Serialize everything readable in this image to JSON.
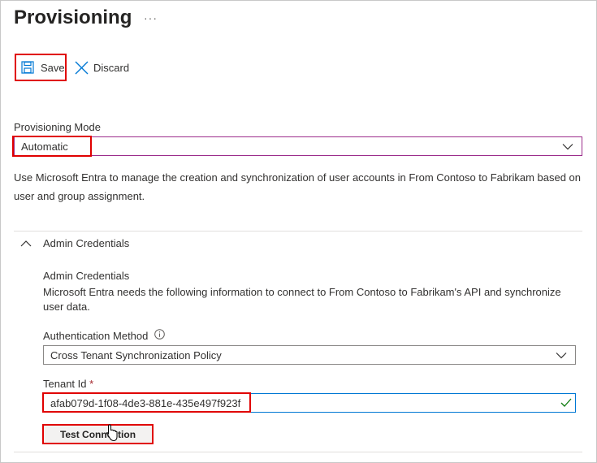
{
  "page": {
    "title": "Provisioning",
    "more_label": "···"
  },
  "toolbar": {
    "save_label": "Save",
    "discard_label": "Discard"
  },
  "provisioning_mode": {
    "label": "Provisioning Mode",
    "selected": "Automatic",
    "description_line1": "Use Microsoft Entra to manage the creation and synchronization of user accounts in From Contoso to Fabrikam based on",
    "description_line2": "user and group assignment."
  },
  "admin_credentials": {
    "section_title": "Admin Credentials",
    "heading": "Admin Credentials",
    "description_line1": "Microsoft Entra needs the following information to connect to From Contoso to Fabrikam's API and synchronize",
    "description_line2": "user data.",
    "auth_method_label": "Authentication Method",
    "auth_method_selected": "Cross Tenant Synchronization Policy",
    "tenant_id_label": "Tenant Id",
    "required_marker": "*",
    "tenant_id_value": "afab079d-1f08-4de3-881e-435e497f923f",
    "test_button_label": "Test Connection"
  },
  "colors": {
    "accent": "#0078d4",
    "highlight": "#e00000",
    "success": "#107c10"
  }
}
